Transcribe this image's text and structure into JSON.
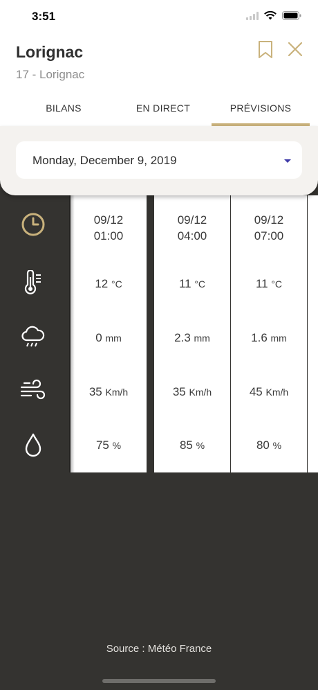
{
  "status_bar": {
    "time": "3:51"
  },
  "header": {
    "title": "Lorignac",
    "subtitle": "17 - Lorignac"
  },
  "tabs": [
    {
      "label": "BILANS"
    },
    {
      "label": "EN DIRECT"
    },
    {
      "label": "PRÉVISIONS",
      "selected": true
    }
  ],
  "date_select": {
    "value": "Monday, December 9, 2019"
  },
  "row_icons": [
    "clock-icon",
    "thermometer-icon",
    "rain-cloud-icon",
    "wind-icon",
    "water-drop-icon"
  ],
  "forecast": [
    {
      "date": "09/12",
      "time": "01:00",
      "temp": "12",
      "temp_unit": "°C",
      "rain": "0",
      "rain_unit": "mm",
      "wind": "35",
      "wind_unit": "Km/h",
      "humidity": "75",
      "humidity_unit": "%"
    },
    {
      "date": "09/12",
      "time": "04:00",
      "temp": "11",
      "temp_unit": "°C",
      "rain": "2.3",
      "rain_unit": "mm",
      "wind": "35",
      "wind_unit": "Km/h",
      "humidity": "85",
      "humidity_unit": "%"
    },
    {
      "date": "09/12",
      "time": "07:00",
      "temp": "11",
      "temp_unit": "°C",
      "rain": "1.6",
      "rain_unit": "mm",
      "wind": "45",
      "wind_unit": "Km/h",
      "humidity": "80",
      "humidity_unit": "%"
    }
  ],
  "footer": {
    "source": "Source : Météo France"
  },
  "colors": {
    "accent": "#c9b27c",
    "dark_bg": "#343330",
    "caret": "#3f3aa8"
  }
}
